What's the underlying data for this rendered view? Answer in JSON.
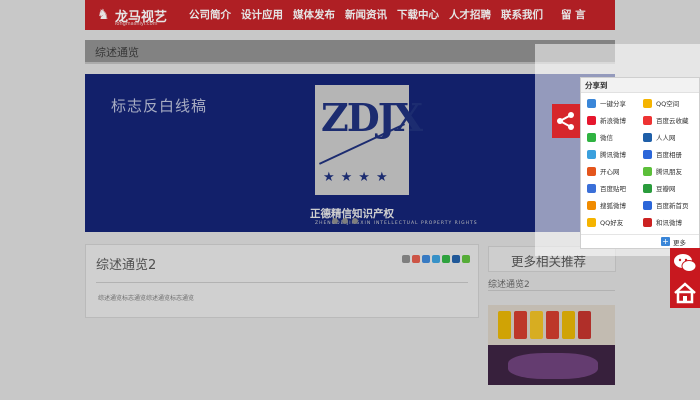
{
  "header": {
    "logo_text": "龙马视艺",
    "logo_sub": "longmashiyi.com",
    "nav": [
      "公司简介",
      "设计应用",
      "媒体发布",
      "新闻资讯",
      "下载中心",
      "人才招聘",
      "联系我们"
    ],
    "nav_last": "留 言"
  },
  "section": {
    "title": "综述通览"
  },
  "banner": {
    "title": "标志反白线稿",
    "badge_text": "ZDJX",
    "badge_caption": "正德精信知识产权",
    "badge_sub": "ZHENGDE JINGXIN INTELLECTUAL PROPERTY RIGHTS"
  },
  "article": {
    "title": "综述通览2",
    "body": "综述通览标志通览综述通览标志通览"
  },
  "sidebar": {
    "more_label": "更多相关推荐",
    "link_label": "综述通览2"
  },
  "share": {
    "header": "分享到",
    "items": [
      {
        "label": "一键分享",
        "color": "#3a86d8"
      },
      {
        "label": "QQ空间",
        "color": "#f5b400"
      },
      {
        "label": "新浪微博",
        "color": "#e6162d"
      },
      {
        "label": "百度云收藏",
        "color": "#e33"
      },
      {
        "label": "微信",
        "color": "#2fb341"
      },
      {
        "label": "人人网",
        "color": "#1f5fa8"
      },
      {
        "label": "腾讯微博",
        "color": "#3aa0dd"
      },
      {
        "label": "百度相册",
        "color": "#2b66d9"
      },
      {
        "label": "开心网",
        "color": "#e4551c"
      },
      {
        "label": "腾讯朋友",
        "color": "#5cbf3a"
      },
      {
        "label": "百度贴吧",
        "color": "#3a6fd8"
      },
      {
        "label": "豆瓣网",
        "color": "#2a9c3c"
      },
      {
        "label": "搜狐微博",
        "color": "#f08b00"
      },
      {
        "label": "百度新首页",
        "color": "#2b66d9"
      },
      {
        "label": "QQ好友",
        "color": "#f5b400"
      },
      {
        "label": "和讯微博",
        "color": "#c22"
      }
    ],
    "more_label": "更多"
  }
}
